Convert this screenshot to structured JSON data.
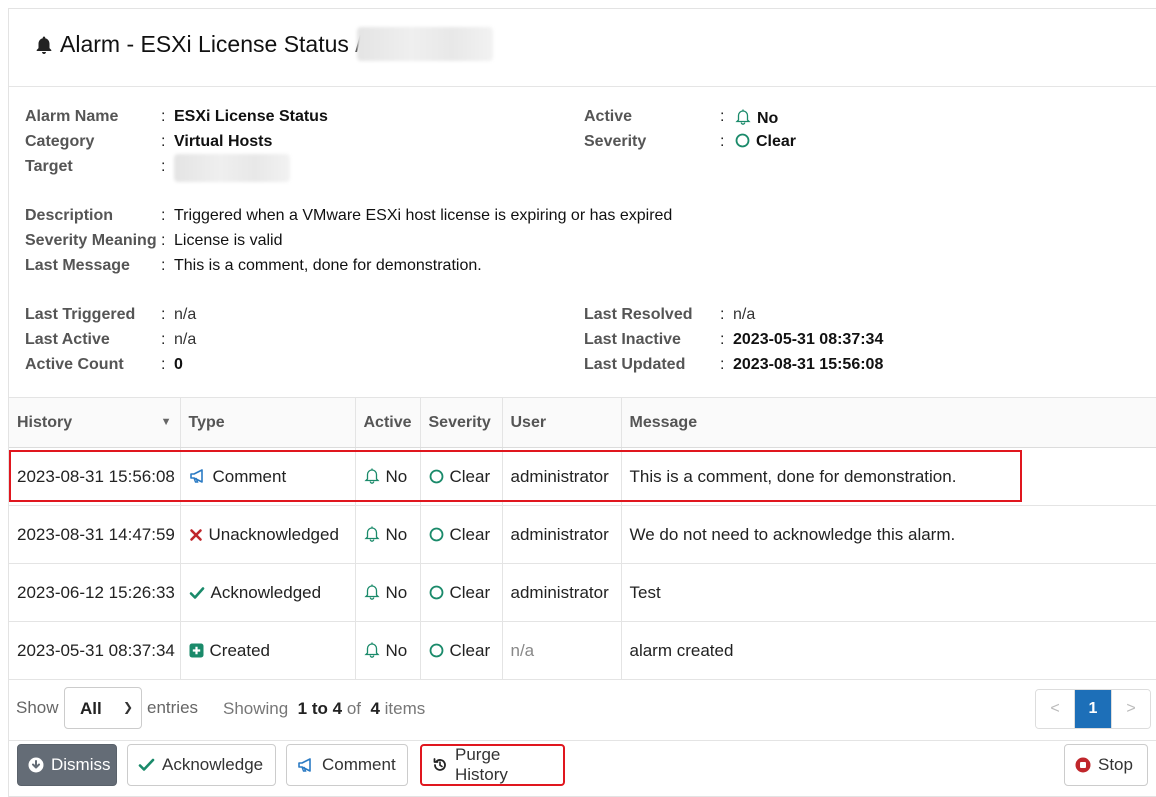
{
  "header": {
    "title": "Alarm - ESXi License Status /"
  },
  "details": {
    "alarm_name_label": "Alarm Name",
    "alarm_name": "ESXi License Status",
    "category_label": "Category",
    "category": "Virtual Hosts",
    "target_label": "Target",
    "active_label": "Active",
    "active": "No",
    "severity_label": "Severity",
    "severity": "Clear",
    "description_label": "Description",
    "description": "Triggered when a VMware ESXi host license is expiring or has expired",
    "severity_meaning_label": "Severity Meaning",
    "severity_meaning": "License is valid",
    "last_message_label": "Last Message",
    "last_message": "This is a comment, done for demonstration.",
    "last_triggered_label": "Last Triggered",
    "last_triggered": "n/a",
    "last_active_label": "Last Active",
    "last_active": "n/a",
    "active_count_label": "Active Count",
    "active_count": "0",
    "last_resolved_label": "Last Resolved",
    "last_resolved": "n/a",
    "last_inactive_label": "Last Inactive",
    "last_inactive": "2023-05-31 08:37:34",
    "last_updated_label": "Last Updated",
    "last_updated": "2023-08-31 15:56:08",
    "colon": ":"
  },
  "table": {
    "headers": [
      "History",
      "Type",
      "Active",
      "Severity",
      "User",
      "Message"
    ],
    "rows": [
      {
        "history": "2023-08-31 15:56:08",
        "type": "Comment",
        "type_icon": "megaphone-icon",
        "active": "No",
        "severity": "Clear",
        "user": "administrator",
        "message": "This is a comment, done for demonstration."
      },
      {
        "history": "2023-08-31 14:47:59",
        "type": "Unacknowledged",
        "type_icon": "x-icon",
        "active": "No",
        "severity": "Clear",
        "user": "administrator",
        "message": "We do not need to acknowledge this alarm."
      },
      {
        "history": "2023-06-12 15:26:33",
        "type": "Acknowledged",
        "type_icon": "check-icon",
        "active": "No",
        "severity": "Clear",
        "user": "administrator",
        "message": "Test"
      },
      {
        "history": "2023-05-31 08:37:34",
        "type": "Created",
        "type_icon": "plus-square-icon",
        "active": "No",
        "severity": "Clear",
        "user": "n/a",
        "message": "alarm created"
      }
    ]
  },
  "pagination": {
    "show_label": "Show",
    "page_size": "All",
    "entries_label": "entries",
    "showing_prefix": "Showing",
    "range": "1 to 4",
    "of": "of",
    "total": "4",
    "items": "items",
    "prev": "<",
    "current_page": "1",
    "next": ">"
  },
  "buttons": {
    "dismiss": "Dismiss",
    "acknowledge": "Acknowledge",
    "comment": "Comment",
    "purge_history": "Purge History",
    "stop": "Stop"
  },
  "colors": {
    "accent_blue": "#1d6fb8",
    "highlight_red": "#e0161e",
    "severity_green": "#1a8a6a",
    "unack_red": "#c0262b",
    "dismiss_gray": "#646c76"
  }
}
